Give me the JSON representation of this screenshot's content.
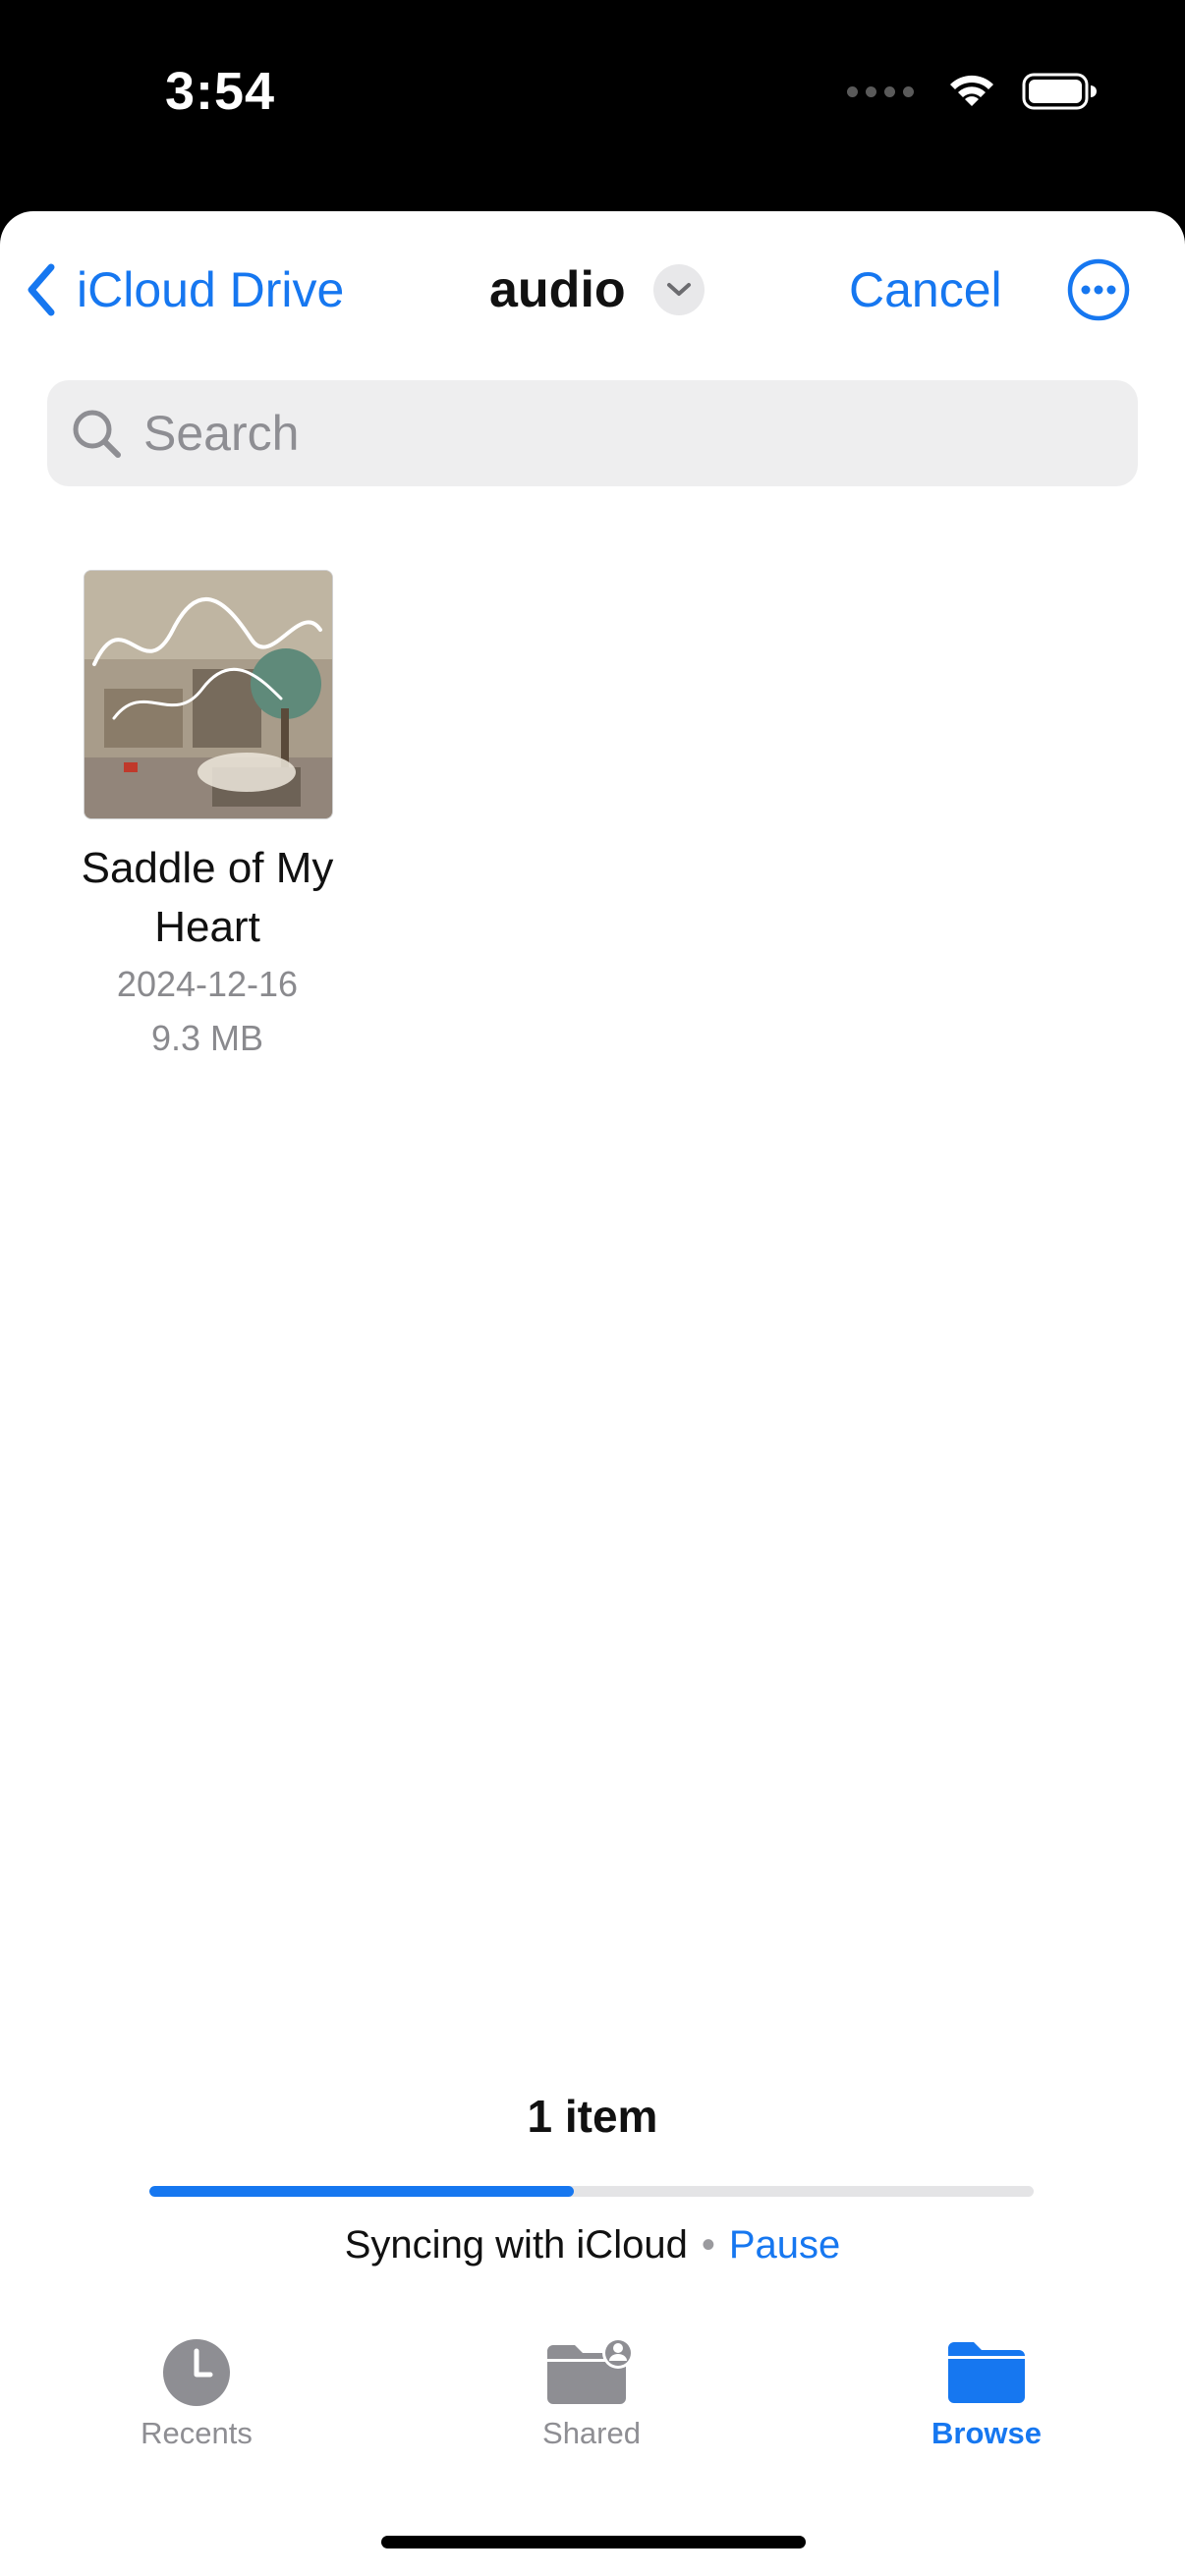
{
  "status_bar": {
    "time": "3:54"
  },
  "nav": {
    "back_label": "iCloud Drive",
    "title": "audio",
    "cancel_label": "Cancel"
  },
  "search": {
    "placeholder": "Search",
    "value": ""
  },
  "files": [
    {
      "name": "Saddle of My Heart",
      "date": "2024-12-16",
      "size": "9.3 MB"
    }
  ],
  "footer": {
    "item_count": "1 item",
    "sync_text": "Syncing with iCloud",
    "separator": "•",
    "pause_label": "Pause",
    "progress": 0.48
  },
  "tabs": [
    {
      "label": "Recents",
      "icon": "clock-icon",
      "active": false
    },
    {
      "label": "Shared",
      "icon": "shared-folder-icon",
      "active": false
    },
    {
      "label": "Browse",
      "icon": "folder-icon",
      "active": true
    }
  ],
  "colors": {
    "accent": "#1677f0",
    "background": "#ffffff",
    "status_bar": "#000000"
  }
}
